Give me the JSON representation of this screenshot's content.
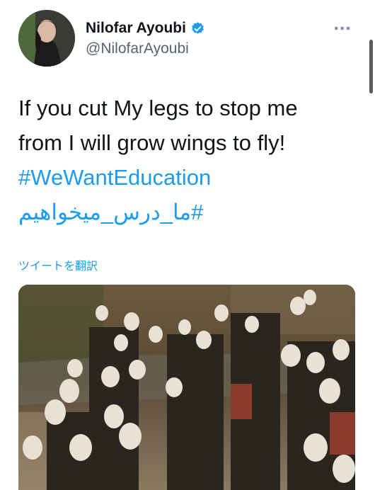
{
  "author": {
    "display_name": "Nilofar Ayoubi",
    "handle": "@NilofarAyoubi",
    "verified": true
  },
  "tweet": {
    "line1": "If you cut My legs to stop me",
    "line2": "from I will grow wings to  fly!",
    "hashtag1": "#WeWantEducation",
    "hashtag2": "#ما_درس_میخواهیم"
  },
  "translate_label": "ツイートを翻訳",
  "more_label": "•••",
  "colors": {
    "link": "#1d9bf0",
    "text": "#0f1419",
    "secondary": "#536471"
  },
  "icons": {
    "verified": "verified-badge-icon",
    "more": "more-options-icon"
  }
}
